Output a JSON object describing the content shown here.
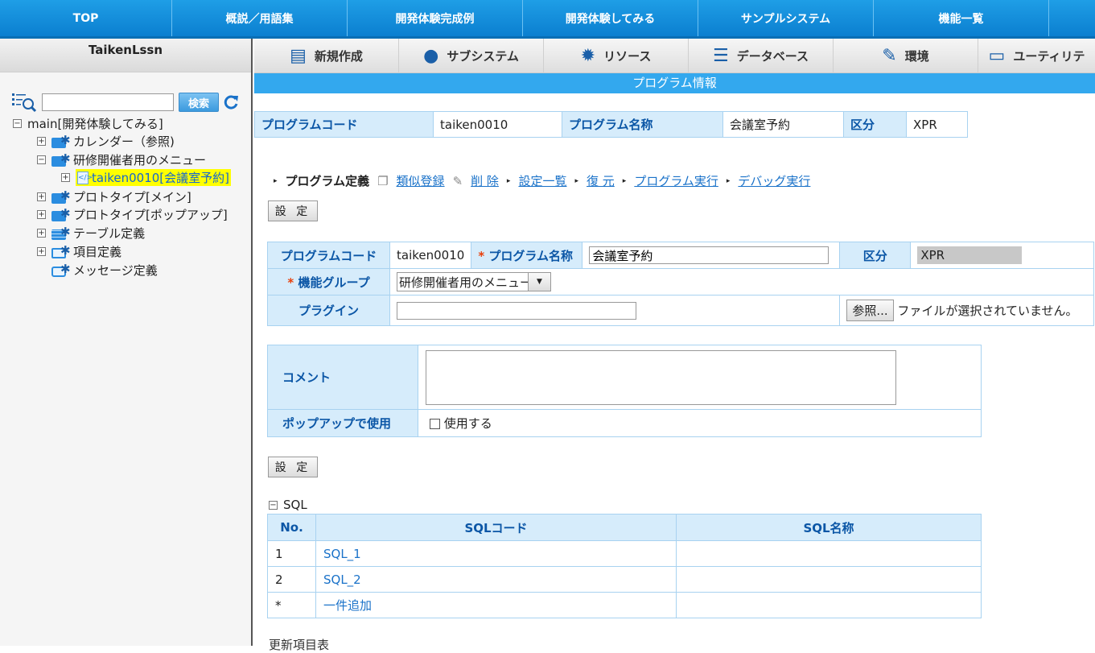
{
  "topnav": [
    "TOP",
    "概説／用語集",
    "開発体験完成例",
    "開発体験してみる",
    "サンプルシステム",
    "機能一覧",
    ""
  ],
  "left": {
    "title": "TaikenLssn",
    "search_button": "検索",
    "tree": {
      "root": "main[開発体験してみる]",
      "calendar": "カレンダー（参照)",
      "menu": "研修開催者用のメニュー",
      "selected": "taiken0010[会議室予約]",
      "proto_main": "プロトタイプ[メイン]",
      "proto_popup": "プロトタイプ[ポップアップ]",
      "table_def": "テーブル定義",
      "item_def": "項目定義",
      "msg_def": "メッセージ定義"
    }
  },
  "toolbar": {
    "new": "新規作成",
    "subsystem": "サブシステム",
    "resource": "リソース",
    "database": "データベース",
    "env": "環境",
    "utility": "ユーティリテ"
  },
  "infobar": "プログラム情報",
  "summary": {
    "code_label": "プログラムコード",
    "code": "taiken0010",
    "name_label": "プログラム名称",
    "name": "会議室予約",
    "kubun_label": "区分",
    "kubun": "XPR"
  },
  "actions": {
    "current": "プログラム定義",
    "similar": "類似登録",
    "delete": "削 除",
    "settings_list": "設定一覧",
    "restore": "復 元",
    "run": "プログラム実行",
    "debug": "デバッグ実行"
  },
  "set_button": "設 定",
  "form": {
    "code_label": "プログラムコード",
    "code": "taiken0010",
    "name_label": "プログラム名称",
    "name": "会議室予約",
    "kubun_label": "区分",
    "kubun": "XPR",
    "group_label": "機能グループ",
    "group": "研修開催者用のメニュー",
    "plugin_label": "プラグイン",
    "browse": "参照...",
    "no_file": "ファイルが選択されていません。",
    "comment_label": "コメント",
    "popup_label": "ポップアップで使用",
    "popup_check": "使用する"
  },
  "sql": {
    "title": "SQL",
    "headers": [
      "No.",
      "SQLコード",
      "SQL名称"
    ],
    "rows": [
      {
        "no": "1",
        "code": "SQL_1",
        "name": ""
      },
      {
        "no": "2",
        "code": "SQL_2",
        "name": ""
      },
      {
        "no": "*",
        "code": "一件追加",
        "name": ""
      }
    ]
  },
  "cutoff": "更新項目表"
}
